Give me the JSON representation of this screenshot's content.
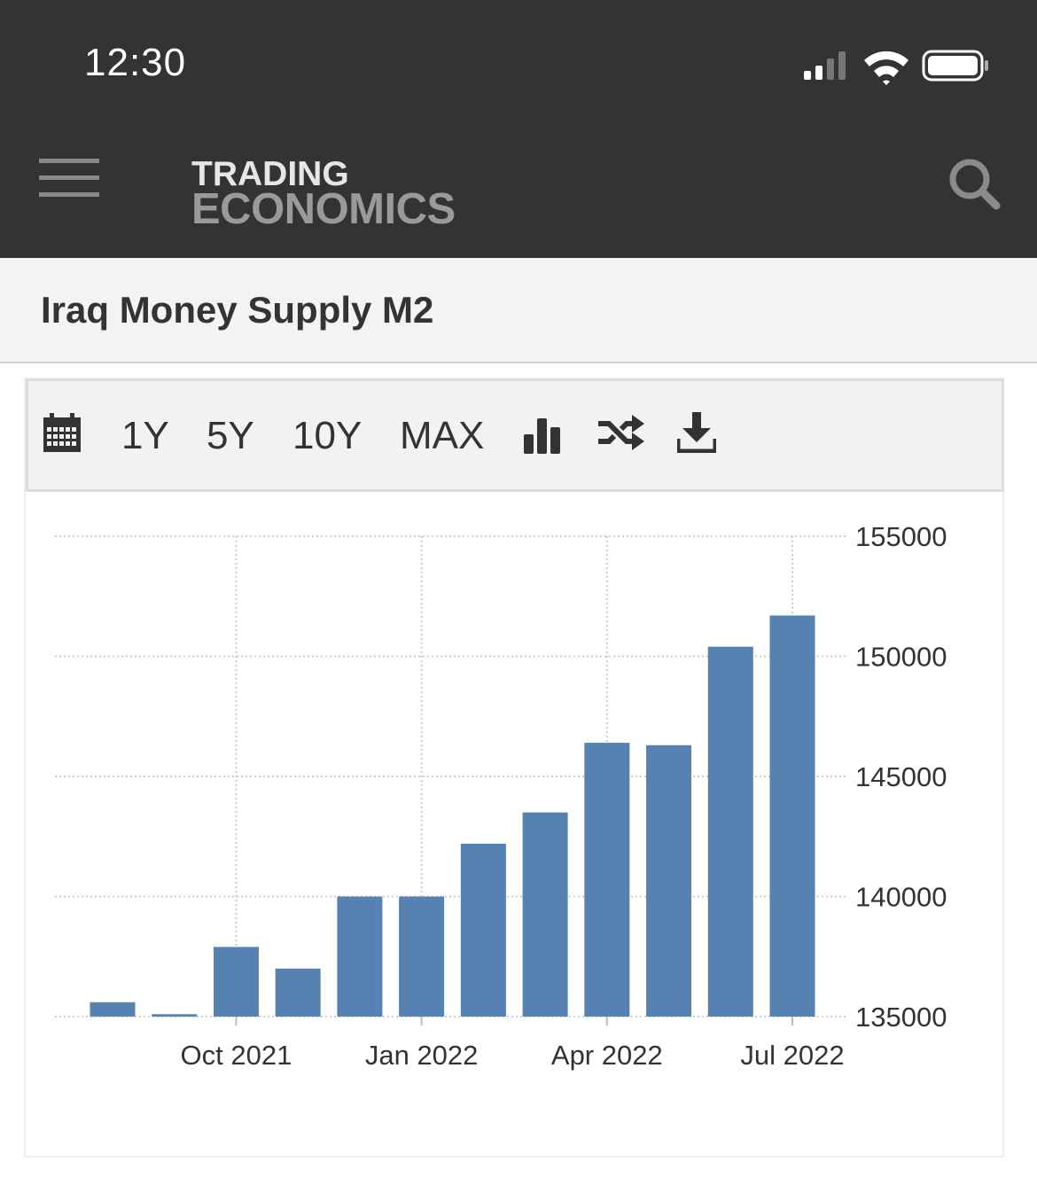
{
  "status_bar": {
    "time": "12:30"
  },
  "header": {
    "logo_line1": "TRADING",
    "logo_line2": "ECONOMICS"
  },
  "page": {
    "title": "Iraq Money Supply M2"
  },
  "toolbar": {
    "range_1y": "1Y",
    "range_5y": "5Y",
    "range_10y": "10Y",
    "range_max": "MAX",
    "icons": [
      "calendar-icon",
      "bar-chart-icon",
      "shuffle-icon",
      "download-icon"
    ]
  },
  "colors": {
    "header_bg": "#333333",
    "bar": "#5682b1",
    "title_band_bg": "#f3f3f3",
    "grid": "#cccccc"
  },
  "chart_data": {
    "type": "bar",
    "categories": [
      "Aug 2021",
      "Sep 2021",
      "Oct 2021",
      "Nov 2021",
      "Dec 2021",
      "Jan 2022",
      "Feb 2022",
      "Mar 2022",
      "Apr 2022",
      "May 2022",
      "Jun 2022",
      "Jul 2022"
    ],
    "values": [
      135600,
      135100,
      137900,
      137000,
      140000,
      140000,
      142200,
      143500,
      146400,
      146300,
      150400,
      151700
    ],
    "x_tick_labels": [
      "Oct 2021",
      "Jan 2022",
      "Apr 2022",
      "Jul 2022"
    ],
    "x_tick_categories": [
      "Oct 2021",
      "Jan 2022",
      "Apr 2022",
      "Jul 2022"
    ],
    "y_ticks": [
      135000,
      140000,
      145000,
      150000,
      155000
    ],
    "ylim": [
      135000,
      155000
    ],
    "y_axis_side": "right",
    "grid": true,
    "title": "",
    "xlabel": "",
    "ylabel": ""
  }
}
